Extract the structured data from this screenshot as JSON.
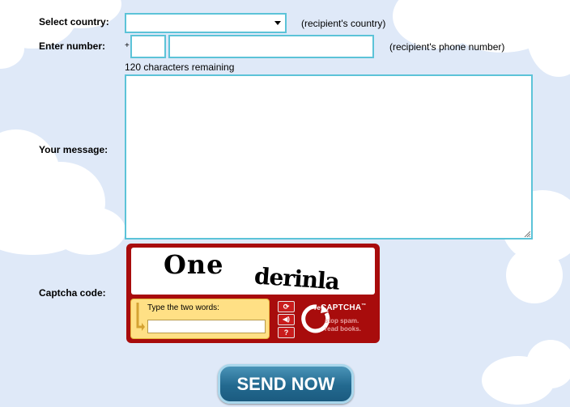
{
  "form": {
    "country_label": "Select country:",
    "country_value": "",
    "country_hint": "(recipient's country)",
    "number_label": "Enter number:",
    "plus_sign": "+",
    "country_code_value": "",
    "phone_value": "",
    "number_hint": "(recipient's phone number)",
    "chars_remaining": "120 characters remaining",
    "message_label": "Your message:",
    "message_value": "",
    "captcha_label": "Captcha code:"
  },
  "captcha": {
    "word1": "One",
    "word2": "derinla",
    "prompt": "Type the two words:",
    "input_value": "",
    "brand_re": "re",
    "brand": "CAPTCHA",
    "trademark": "™",
    "tagline_1": "stop spam.",
    "tagline_2": "read books.",
    "buttons": [
      {
        "icon": "refresh-icon",
        "glyph": "⟳"
      },
      {
        "icon": "audio-icon",
        "glyph": "◀)"
      },
      {
        "icon": "help-icon",
        "glyph": "?"
      }
    ]
  },
  "send_button": {
    "label": "SEND NOW"
  },
  "colors": {
    "background": "#dfe9f8",
    "field_border": "#5cc3d8",
    "captcha_red": "#a80c0c",
    "captcha_panel": "#ffe085",
    "send_button": "#23698f"
  }
}
